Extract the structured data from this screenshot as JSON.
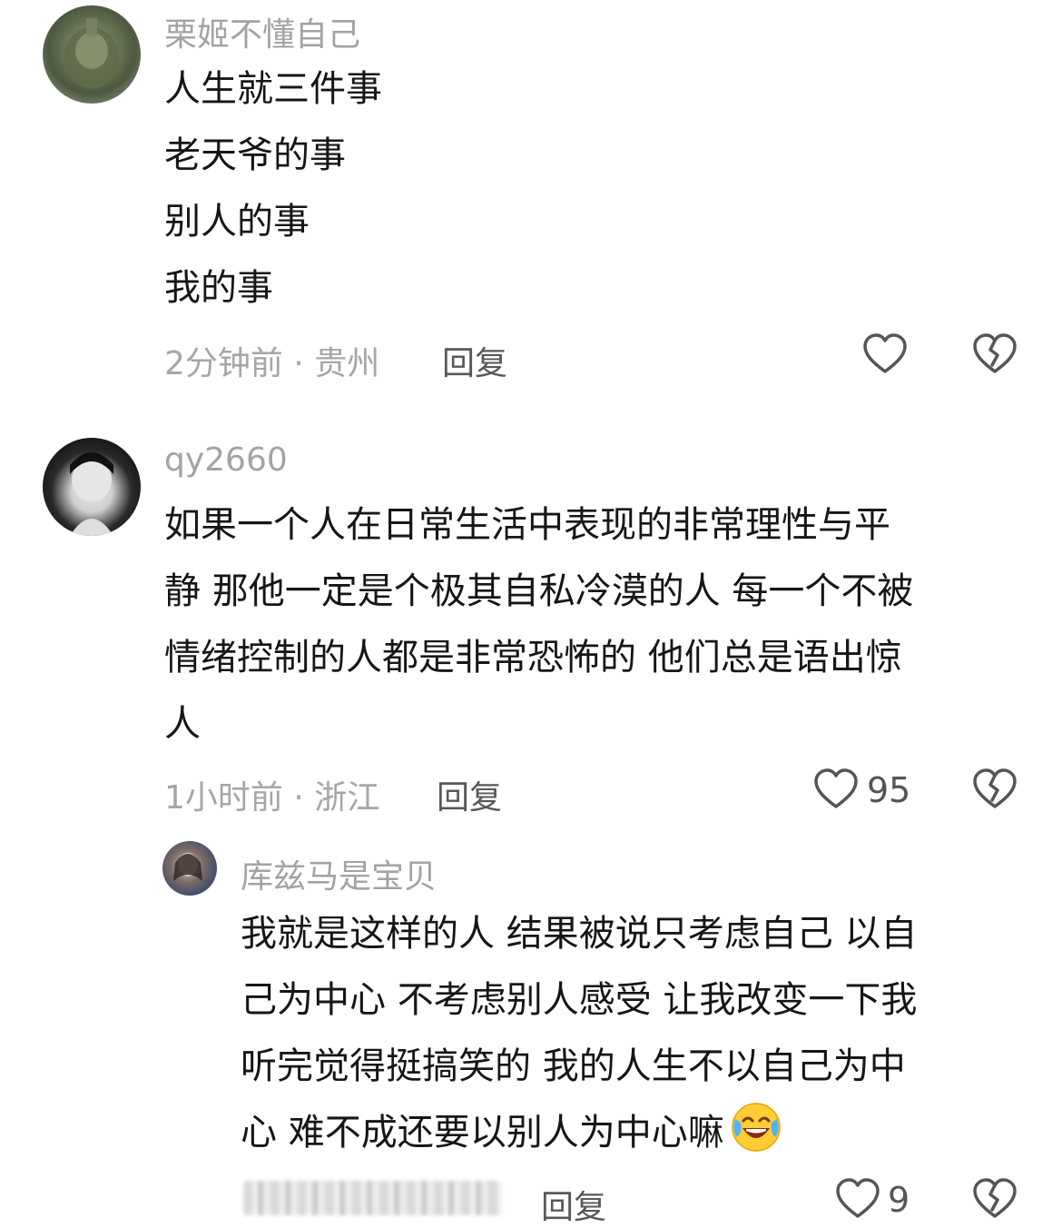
{
  "comments": [
    {
      "username": "栗姬不懂自己",
      "lines": [
        "人生就三件事",
        "老天爷的事",
        "别人的事",
        "我的事"
      ],
      "meta": "2分钟前 · 贵州",
      "reply_label": "回复",
      "like_count": ""
    },
    {
      "username": "qy2660",
      "lines": [
        "如果一个人在日常生活中表现的非常理性与平",
        "静 那他一定是个极其自私冷漠的人 每一个不被",
        "情绪控制的人都是非常恐怖的 他们总是语出惊",
        "人"
      ],
      "meta": "1小时前 · 浙江",
      "reply_label": "回复",
      "like_count": "95",
      "replies": [
        {
          "username": "库兹马是宝贝",
          "lines": [
            "我就是这样的人 结果被说只考虑自己 以自",
            "己为中心 不考虑别人感受 让我改变一下我",
            "听完觉得挺搞笑的 我的人生不以自己为中",
            "心 难不成还要以别人为中心嘛"
          ],
          "emoji": "laughing-crying-emoji",
          "reply_label": "回复",
          "like_count": "9"
        }
      ]
    }
  ],
  "icons": {
    "like": "heart-outline-icon",
    "dislike": "broken-heart-icon"
  },
  "colors": {
    "username": "#a3a3a3",
    "text": "#161616",
    "meta": "#a6a6a6",
    "reply": "#585858",
    "icon": "#555555"
  }
}
